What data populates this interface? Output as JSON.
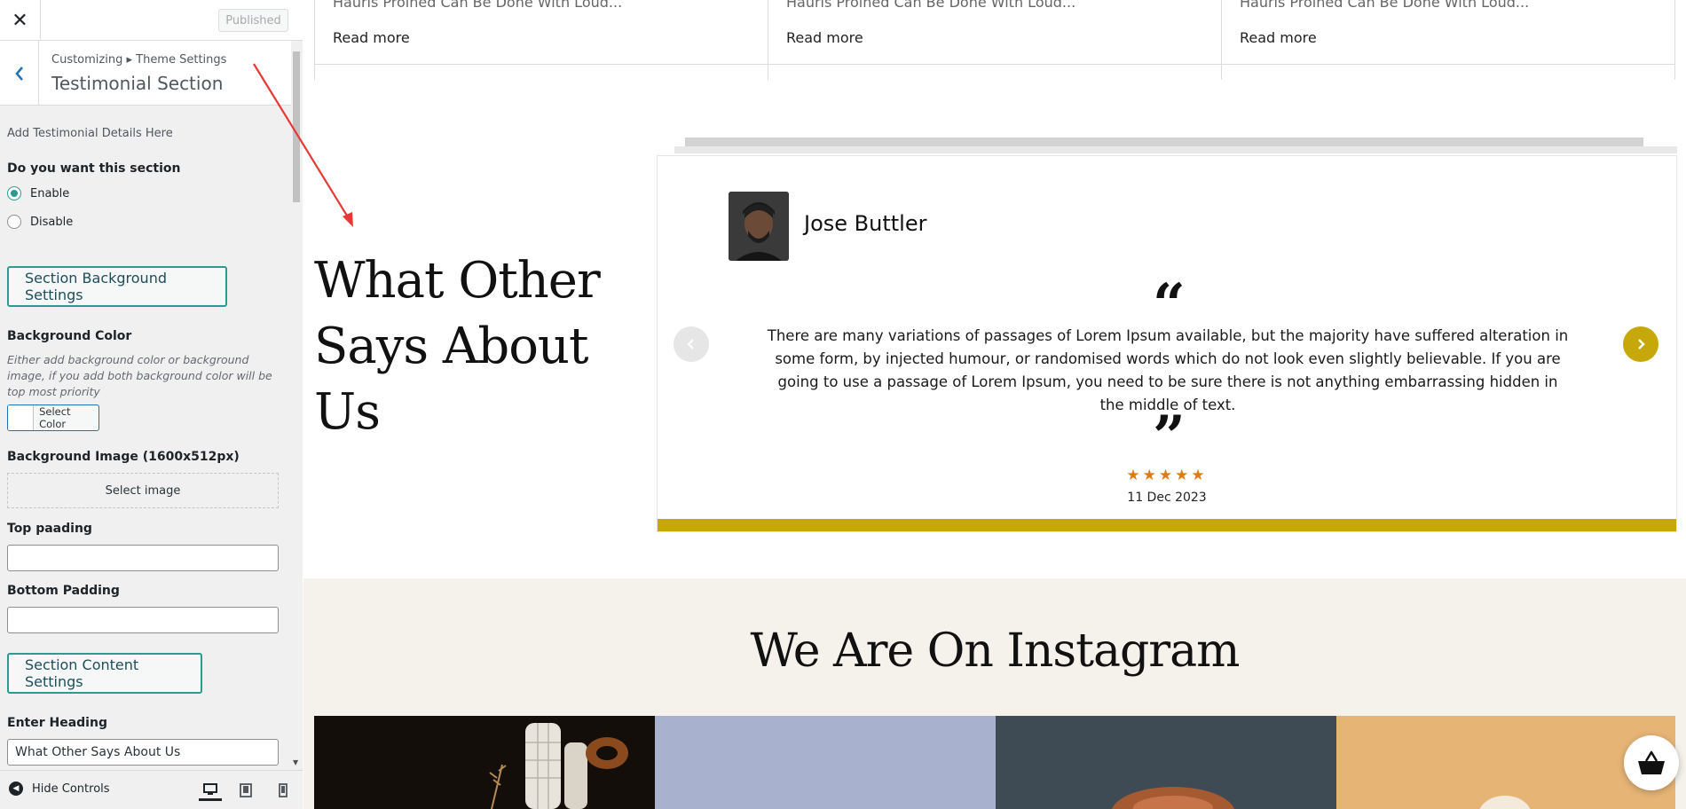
{
  "customizer": {
    "close_icon": "close-icon",
    "published_label": "Published",
    "breadcrumb": "Customizing ▸ Theme Settings",
    "section_title": "Testimonial Section",
    "description": "Add Testimonial Details Here",
    "section_toggle": {
      "label": "Do you want this section",
      "options": [
        "Enable",
        "Disable"
      ],
      "selected": "Enable"
    },
    "bg_settings_button": "Section Background Settings",
    "background_color": {
      "label": "Background Color",
      "description": "Either add background color or background image, if you add both background color will be top most priority",
      "button_label": "Select Color"
    },
    "background_image": {
      "label": "Background Image (1600x512px)",
      "button_label": "Select image"
    },
    "top_padding": {
      "label": "Top paading",
      "value": ""
    },
    "bottom_padding": {
      "label": "Bottom Padding",
      "value": ""
    },
    "content_settings_button": "Section Content Settings",
    "heading_field": {
      "label": "Enter Heading",
      "value": "What Other Says About Us"
    },
    "footer": {
      "hide_controls_label": "Hide Controls",
      "devices": [
        "desktop",
        "tablet",
        "mobile"
      ],
      "active_device": "desktop"
    }
  },
  "preview": {
    "posts": [
      {
        "snippet": "Hauris Proined Can Be Done With Loud...",
        "read_more": "Read more"
      },
      {
        "snippet": "Hauris Proined Can Be Done With Loud...",
        "read_more": "Read more"
      },
      {
        "snippet": "Hauris Proined Can Be Done With Loud...",
        "read_more": "Read more"
      }
    ],
    "testimonial_section": {
      "heading": "What Other Says About Us",
      "name": "Jose Buttler",
      "quote_open": "“",
      "quote_close": "”",
      "text": "There are many variations of passages of Lorem Ipsum available, but the majority have suffered alteration in some form, by injected humour, or randomised words which do not look even slightly believable. If you are going to use a passage of Lorem Ipsum, you need to be sure there is not anything embarrassing hidden in the middle of text.",
      "rating": 5,
      "stars": "★★★★★",
      "date": "11 Dec 2023",
      "accent_color": "#c6a80a",
      "star_color": "#e07b12"
    },
    "instagram_section": {
      "heading": "We Are On Instagram",
      "background_color": "#f5f1eb"
    }
  }
}
